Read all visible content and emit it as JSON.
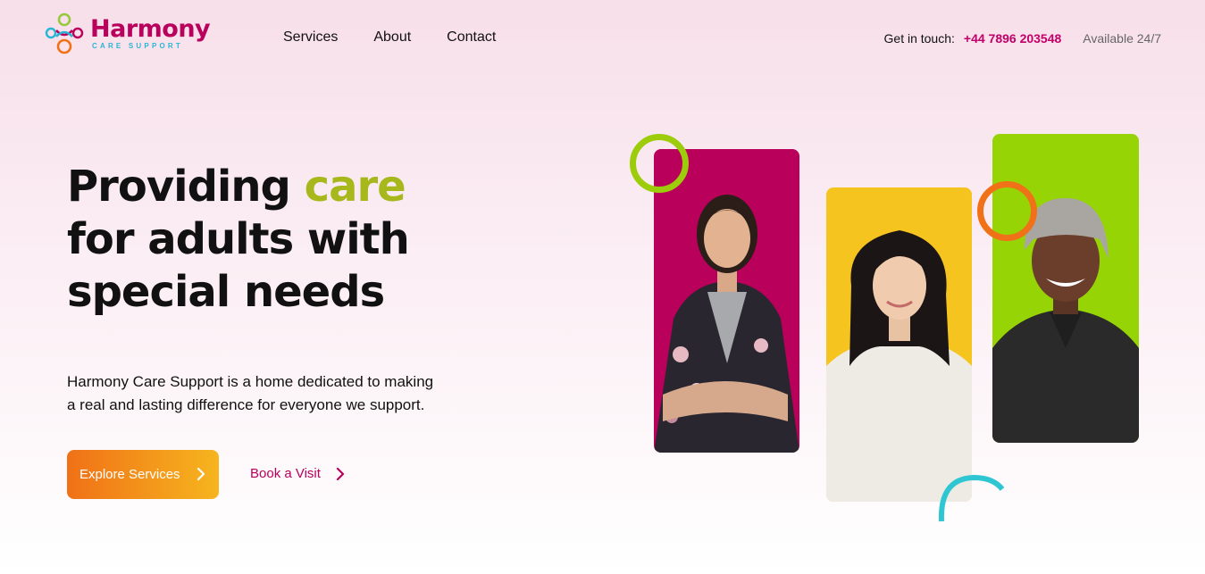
{
  "brand": {
    "name": "Harmony",
    "tagline": "CARE SUPPORT",
    "colors": {
      "primary": "#b8005c",
      "accent_green": "#a6b81c",
      "orange": "#f07117",
      "yellow": "#f6b51e",
      "cyan": "#29c4d6"
    }
  },
  "nav": {
    "items": [
      {
        "label": "Services"
      },
      {
        "label": "About"
      },
      {
        "label": "Contact"
      }
    ]
  },
  "contact": {
    "label": "Get in touch:",
    "phone": "+44 7896 203548",
    "availability": "Available 24/7"
  },
  "hero": {
    "title_part1": "Providing ",
    "title_accent": "care",
    "title_line2": "for adults with",
    "title_line3": "special needs",
    "description": "Harmony Care Support is a home dedicated to making a real and lasting difference for everyone we support.",
    "primary_cta": "Explore Services",
    "secondary_cta": "Book a Visit"
  },
  "gallery": {
    "cards": [
      {
        "icon": "person-photo-woman-dark-hair",
        "background": "#b9005a"
      },
      {
        "icon": "person-photo-woman-long-hair",
        "background": "#f5c41f"
      },
      {
        "icon": "person-photo-man-beanie",
        "background": "#96d406"
      }
    ]
  }
}
